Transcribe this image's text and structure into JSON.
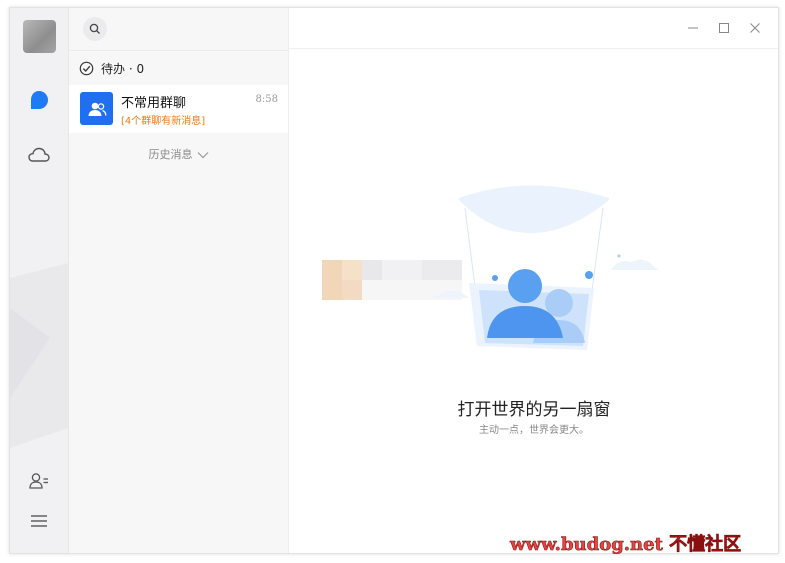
{
  "title_bar": {
    "search_icon": "search-icon",
    "minimize_icon": "minimize-icon",
    "maximize_icon": "maximize-icon",
    "close_icon": "close-icon"
  },
  "rail": {
    "items": [
      {
        "icon": "chat-bubble-icon",
        "active": true
      },
      {
        "icon": "cloud-icon",
        "active": false
      }
    ],
    "bottom": [
      {
        "icon": "contacts-icon"
      },
      {
        "icon": "menu-icon"
      }
    ]
  },
  "todo": {
    "label": "待办 · 0"
  },
  "conversations": [
    {
      "name": "不常用群聊",
      "time": "8:58",
      "preview": "[4个群聊有新消息]"
    }
  ],
  "history": {
    "label": "历史消息"
  },
  "empty_state": {
    "headline": "打开世界的另一扇窗",
    "subline": "主动一点，世界会更大。"
  },
  "watermark": {
    "text": "www.budog.net 不懂社区"
  },
  "colors": {
    "accent": "#1f6ff0",
    "preview_orange": "#f07b1a",
    "rail_bg": "#f1f1f3",
    "list_bg": "#f7f7f8"
  }
}
